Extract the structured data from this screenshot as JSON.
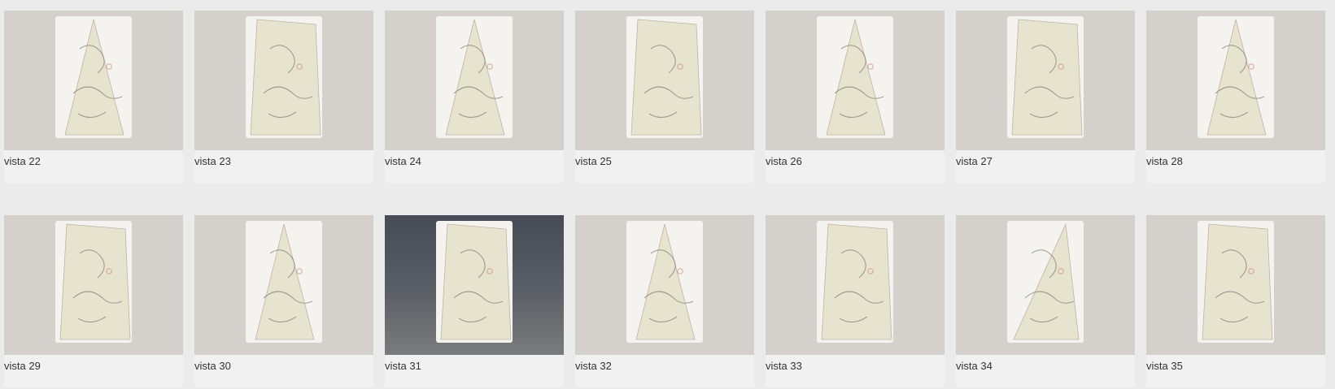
{
  "gallery": {
    "items": [
      {
        "label": "vista 22",
        "shape": "tri"
      },
      {
        "label": "vista 23",
        "shape": "trap"
      },
      {
        "label": "vista 24",
        "shape": "tri"
      },
      {
        "label": "vista 25",
        "shape": "trap"
      },
      {
        "label": "vista 26",
        "shape": "tri"
      },
      {
        "label": "vista 27",
        "shape": "trap"
      },
      {
        "label": "vista 28",
        "shape": "tri"
      },
      {
        "label": "vista 29",
        "shape": "trap"
      },
      {
        "label": "vista 30",
        "shape": "tri"
      },
      {
        "label": "vista 31",
        "shape": "trap",
        "selected": true
      },
      {
        "label": "vista 32",
        "shape": "tri"
      },
      {
        "label": "vista 33",
        "shape": "trap"
      },
      {
        "label": "vista 34",
        "shape": "slant"
      },
      {
        "label": "vista 35",
        "shape": "trap"
      }
    ]
  }
}
